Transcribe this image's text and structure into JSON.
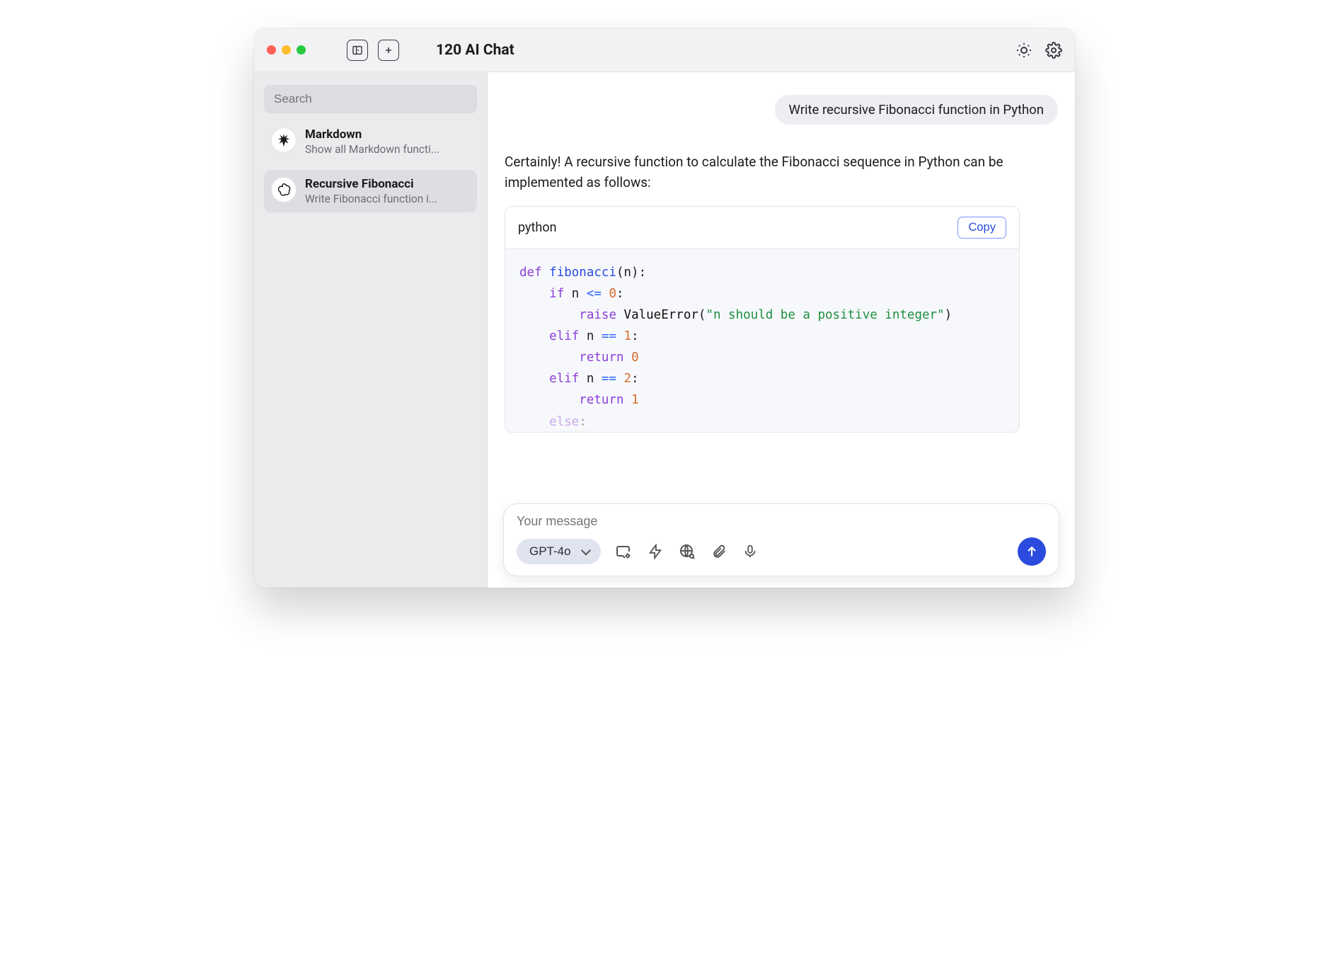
{
  "app": {
    "title": "120 AI Chat"
  },
  "search": {
    "placeholder": "Search"
  },
  "threads": [
    {
      "icon": "starburst",
      "title": "Markdown",
      "subtitle": "Show all Markdown functi...",
      "selected": false
    },
    {
      "icon": "openai",
      "title": "Recursive Fibonacci",
      "subtitle": "Write Fibonacci function i...",
      "selected": true
    }
  ],
  "chat": {
    "user_message": "Write recursive Fibonacci function in Python",
    "assistant_intro": "Certainly! A recursive function to calculate the Fibonacci sequence in Python can be implemented as follows:",
    "code": {
      "language": "python",
      "copy_label": "Copy",
      "lines": [
        "def fibonacci(n):",
        "    if n <= 0:",
        "        raise ValueError(\"n should be a positive integer\")",
        "    elif n == 1:",
        "        return 0",
        "    elif n == 2:",
        "        return 1",
        "    else:"
      ]
    }
  },
  "composer": {
    "placeholder": "Your message",
    "model": "GPT-4o"
  }
}
